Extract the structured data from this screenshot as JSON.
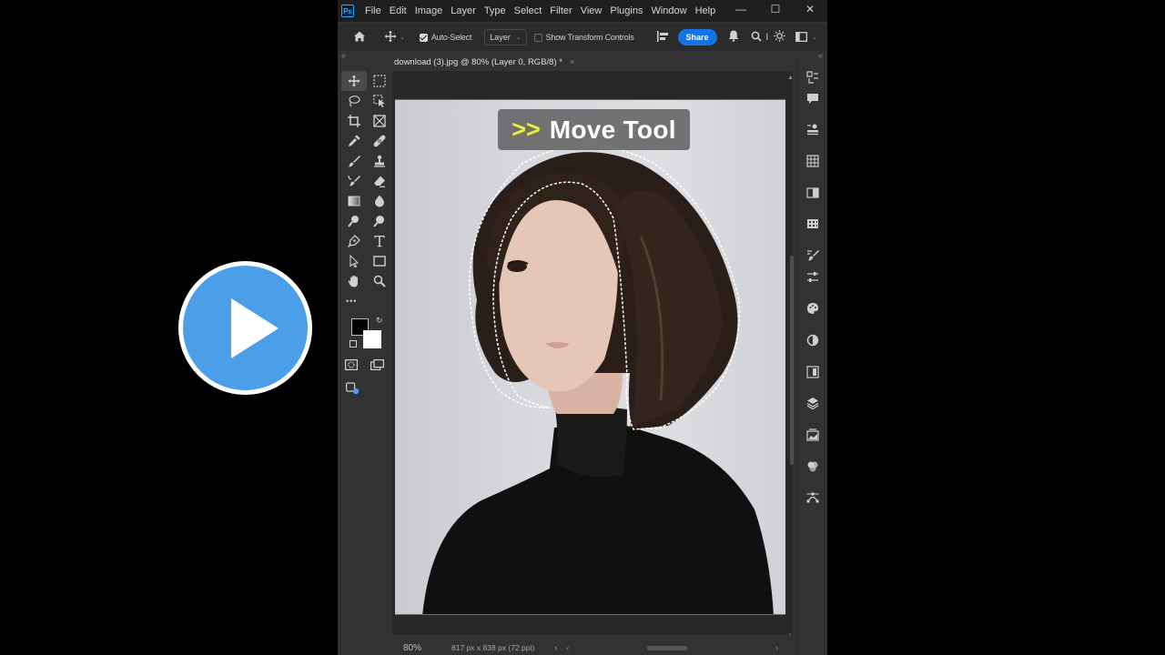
{
  "window": {
    "app_logo": "Ps",
    "menu": [
      "File",
      "Edit",
      "Image",
      "Layer",
      "Type",
      "Select",
      "Filter",
      "View",
      "Plugins",
      "Window",
      "Help"
    ],
    "controls": {
      "minimize": "—",
      "maximize": "☐",
      "close": "✕"
    }
  },
  "options_bar": {
    "auto_select_label": "Auto-Select",
    "auto_select_checked": true,
    "target_dropdown": "Layer",
    "transform_label": "Show Transform Controls",
    "transform_checked": false,
    "share_label": "Share",
    "icons": [
      "home-icon",
      "move-icon",
      "align-icon",
      "bell-icon",
      "search-icon",
      "sun-icon",
      "workspace-icon"
    ]
  },
  "document": {
    "tab_title": "download (3).jpg @ 80% (Layer 0, RGB/8) *",
    "tab_close": "×",
    "caption_arrows": ">>",
    "caption_text": "Move Tool"
  },
  "toolbar": {
    "tools": [
      "move-tool",
      "marquee-tool",
      "lasso-tool",
      "object-select-tool",
      "crop-tool",
      "frame-tool",
      "eyedropper-tool",
      "healing-tool",
      "brush-tool",
      "stamp-tool",
      "history-brush-tool",
      "eraser-tool",
      "gradient-tool",
      "blur-tool",
      "dodge-tool",
      "sponge-tool",
      "pen-tool",
      "type-tool",
      "path-select-tool",
      "rectangle-tool",
      "hand-tool",
      "zoom-tool"
    ],
    "more": "•••",
    "foreground_color": "#000000",
    "background_color": "#ffffff"
  },
  "status_bar": {
    "zoom": "80%",
    "doc_info": "817 px x 838 px (72 ppi)",
    "arrow": "›"
  },
  "colors": {
    "accent": "#1473e6",
    "play_button": "#4a9fe8",
    "caption_arrow": "#e8f036"
  }
}
